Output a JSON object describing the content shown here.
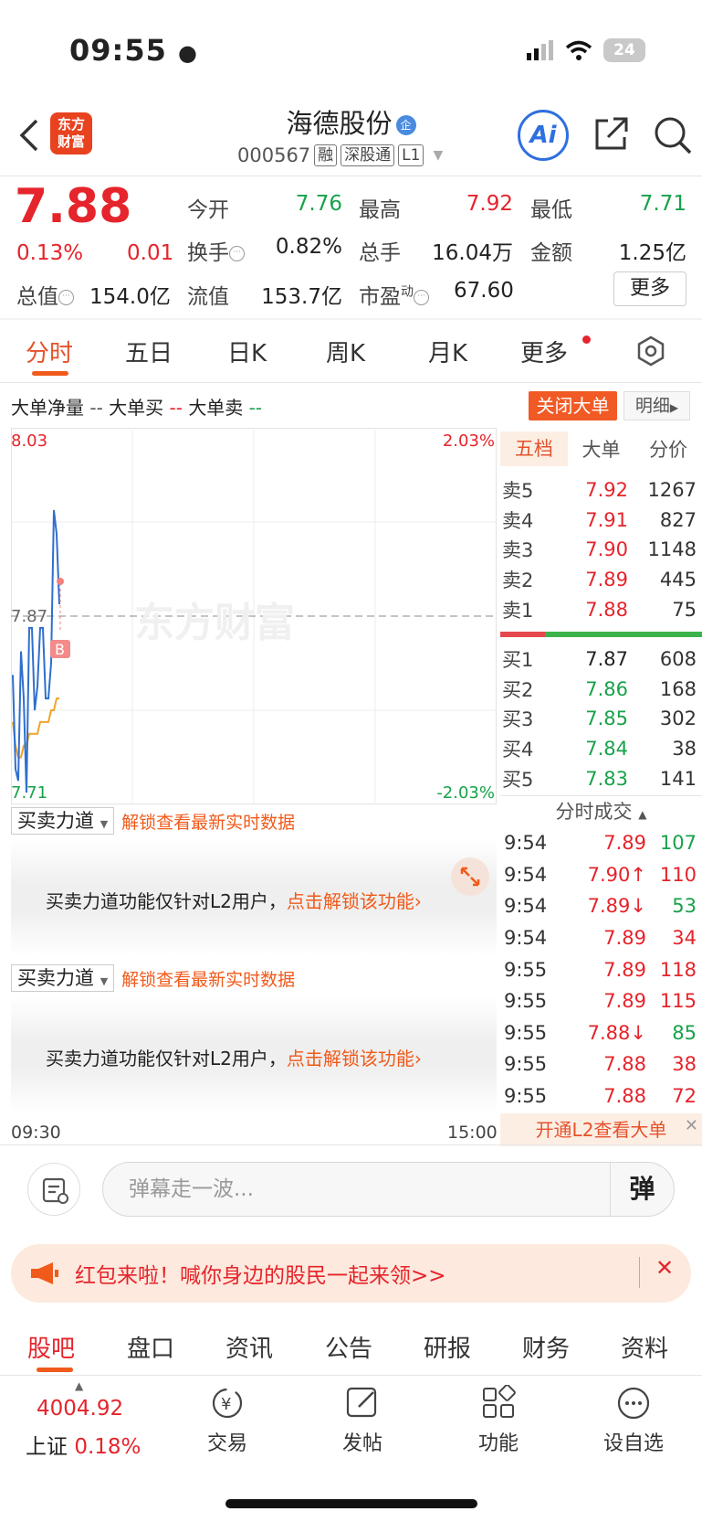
{
  "status": {
    "time": "09:55",
    "battery": "24"
  },
  "header": {
    "logo": "东方财富",
    "name": "海德股份",
    "corp_badge": "企",
    "code": "000567",
    "tags": [
      "融",
      "深股通",
      "L1"
    ],
    "ai_label": "Ai"
  },
  "quote": {
    "price": "7.88",
    "change_pct": "0.13%",
    "change_abs": "0.01",
    "open_label": "今开",
    "open": "7.76",
    "high_label": "最高",
    "high": "7.92",
    "low_label": "最低",
    "low": "7.71",
    "turnover_label": "换手",
    "turnover": "0.82%",
    "volume_label": "总手",
    "volume": "16.04万",
    "amount_label": "金额",
    "amount": "1.25亿",
    "mcap_label": "总值",
    "mcap": "154.0亿",
    "float_label": "流值",
    "float": "153.7亿",
    "pe_label": "市盈",
    "pe_sup": "动",
    "pe": "67.60",
    "more": "更多"
  },
  "tabs": [
    "分时",
    "五日",
    "日K",
    "周K",
    "月K",
    "更多"
  ],
  "bigorder": {
    "net": "大单净量",
    "net_val": "--",
    "buy": "大单买",
    "buy_val": "--",
    "sell": "大单卖",
    "sell_val": "--",
    "close_btn": "关闭大单",
    "detail_btn": "明细"
  },
  "chart": {
    "y_max": "8.03",
    "y_min": "7.71",
    "y_mid": "7.87",
    "pct_max": "2.03%",
    "pct_min": "-2.03%",
    "time_start": "09:30",
    "time_end": "15:00",
    "marker": "B",
    "watermark": "东方财富"
  },
  "chart_data": {
    "type": "line",
    "ylim": [
      7.71,
      8.03
    ],
    "reference": 7.87,
    "series": [
      {
        "values": [
          7.82,
          7.74,
          7.73,
          7.84,
          7.8,
          7.72,
          7.86,
          7.86,
          7.79,
          7.81,
          7.86,
          7.86,
          7.8,
          7.8,
          7.83,
          7.96,
          7.94,
          7.88
        ]
      },
      {
        "values": [
          7.78,
          7.76,
          7.75,
          7.75,
          7.76,
          7.76,
          7.77,
          7.77,
          7.77,
          7.77,
          7.78,
          7.78,
          7.78,
          7.78,
          7.79,
          7.79,
          7.8,
          7.8
        ]
      }
    ]
  },
  "orderbook": {
    "tabs": [
      "五档",
      "大单",
      "分价"
    ],
    "asks": [
      {
        "label": "卖5",
        "price": "7.92",
        "vol": "1267"
      },
      {
        "label": "卖4",
        "price": "7.91",
        "vol": "827"
      },
      {
        "label": "卖3",
        "price": "7.90",
        "vol": "1148"
      },
      {
        "label": "卖2",
        "price": "7.89",
        "vol": "445"
      },
      {
        "label": "卖1",
        "price": "7.88",
        "vol": "75"
      }
    ],
    "bids": [
      {
        "label": "买1",
        "price": "7.87",
        "vol": "608"
      },
      {
        "label": "买2",
        "price": "7.86",
        "vol": "168"
      },
      {
        "label": "买3",
        "price": "7.85",
        "vol": "302"
      },
      {
        "label": "买4",
        "price": "7.84",
        "vol": "38"
      },
      {
        "label": "买5",
        "price": "7.83",
        "vol": "141"
      }
    ],
    "ticks_title": "分时成交",
    "ticks": [
      {
        "t": "9:54",
        "p": "7.89",
        "v": "107",
        "vc": "green"
      },
      {
        "t": "9:54",
        "p": "7.90↑",
        "v": "110",
        "vc": "red"
      },
      {
        "t": "9:54",
        "p": "7.89↓",
        "v": "53",
        "vc": "green"
      },
      {
        "t": "9:54",
        "p": "7.89",
        "v": "34",
        "vc": "red"
      },
      {
        "t": "9:55",
        "p": "7.89",
        "v": "118",
        "vc": "red"
      },
      {
        "t": "9:55",
        "p": "7.89",
        "v": "115",
        "vc": "red"
      },
      {
        "t": "9:55",
        "p": "7.88↓",
        "v": "85",
        "vc": "green"
      },
      {
        "t": "9:55",
        "p": "7.88",
        "v": "38",
        "vc": "red"
      },
      {
        "t": "9:55",
        "p": "7.88",
        "v": "72",
        "vc": "red"
      }
    ],
    "l2_cta": "开通L2查看大单"
  },
  "l2": {
    "select_label": "买卖力道",
    "unlock_link": "解锁查看最新实时数据",
    "msg": "买卖力道功能仅针对L2用户，",
    "msg_link": "点击解锁该功能",
    "arrow": "›"
  },
  "danmu": {
    "placeholder": "弹幕走一波...",
    "btn": "弹"
  },
  "banner": {
    "text": "红包来啦！喊你身边的股民一起来领>>"
  },
  "bottom_tabs": [
    "股吧",
    "盘口",
    "资讯",
    "公告",
    "研报",
    "财务",
    "资料"
  ],
  "footer": {
    "index_value": "4004.92",
    "index_name": "上证",
    "index_pct": "0.18%",
    "nav": [
      "交易",
      "发帖",
      "功能",
      "设自选"
    ]
  }
}
